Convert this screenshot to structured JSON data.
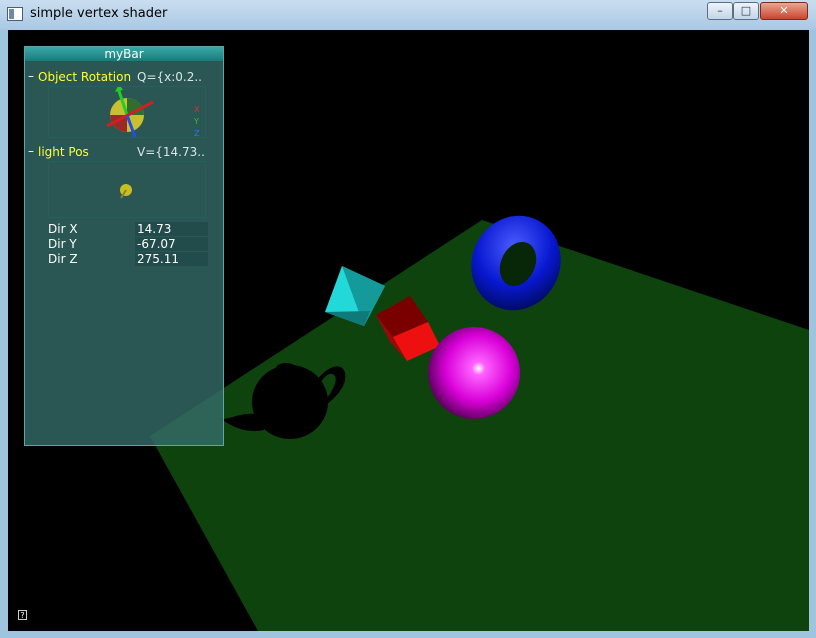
{
  "window": {
    "title": "simple vertex shader"
  },
  "controls": {
    "minimize": "–",
    "maximize": "□",
    "close": "✕"
  },
  "tweakbar": {
    "title": "myBar",
    "rotation": {
      "label": "Object Rotation",
      "value": "Q={x:0.2..",
      "axis_x": "X",
      "axis_y": "Y",
      "axis_z": "Z"
    },
    "light": {
      "label": "light Pos",
      "value": "V={14.73.."
    },
    "dir": [
      {
        "label": "Dir X",
        "value": "14.73"
      },
      {
        "label": "Dir Y",
        "value": "-67.07"
      },
      {
        "label": "Dir Z",
        "value": "275.11"
      }
    ],
    "collapse_symbol": "–"
  },
  "help": {
    "symbol": "?"
  },
  "colors": {
    "floor": "#0f4a0f",
    "torus": "#0a1ad8",
    "sphere": "#e400e4",
    "cube": "#e01010",
    "pyramid": "#20c8c8",
    "group_label": "#ffff33"
  }
}
